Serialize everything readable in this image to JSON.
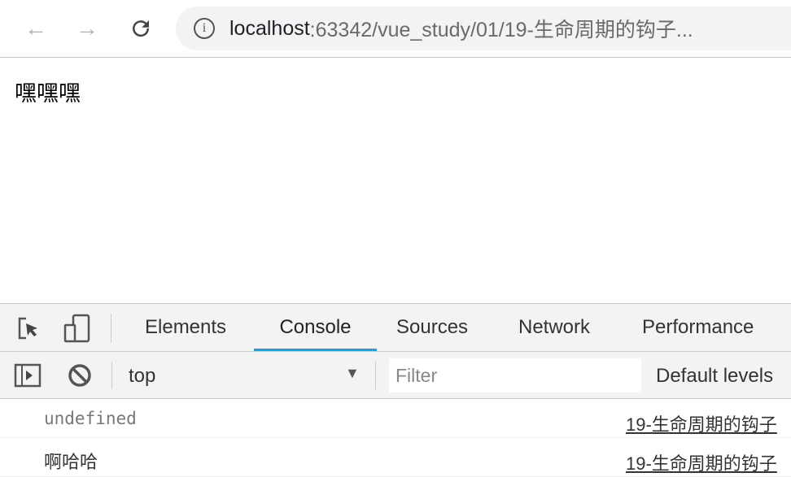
{
  "browser": {
    "url_host": "localhost",
    "url_rest": ":63342/vue_study/01/19-生命周期的钩子..."
  },
  "page": {
    "text": "嘿嘿嘿"
  },
  "devtools": {
    "tabs": [
      {
        "label": "Elements"
      },
      {
        "label": "Console",
        "active": true
      },
      {
        "label": "Sources"
      },
      {
        "label": "Network"
      },
      {
        "label": "Performance"
      }
    ],
    "context": "top",
    "filter_placeholder": "Filter",
    "levels": "Default levels",
    "messages": [
      {
        "text": "undefined",
        "source": "19-生命周期的钩子"
      },
      {
        "text": "啊哈哈",
        "source": "19-生命周期的钩子"
      }
    ],
    "accent": "#03a9f4"
  }
}
